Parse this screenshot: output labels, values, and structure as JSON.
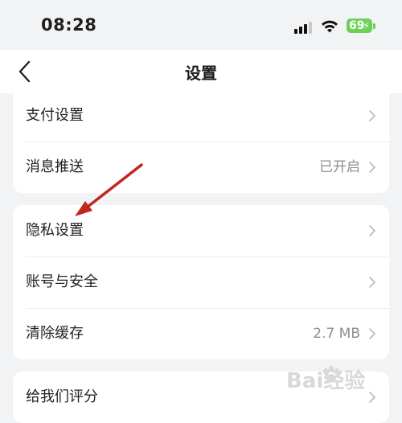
{
  "status_bar": {
    "time": "08:28",
    "battery_level": "69",
    "icons": [
      "signal-icon",
      "wifi-icon",
      "battery-charging-icon"
    ]
  },
  "nav": {
    "title": "设置",
    "back_icon": "chevron-left-icon"
  },
  "groups": [
    {
      "rows": [
        {
          "label": "支付设置",
          "value": ""
        },
        {
          "label": "消息推送",
          "value": "已开启"
        }
      ]
    },
    {
      "rows": [
        {
          "label": "隐私设置",
          "value": ""
        },
        {
          "label": "账号与安全",
          "value": ""
        },
        {
          "label": "清除缓存",
          "value": "2.7 MB"
        }
      ]
    },
    {
      "rows": [
        {
          "label": "给我们评分",
          "value": ""
        }
      ]
    }
  ],
  "annotation": {
    "color": "#c0281f",
    "points_to": "隐私设置"
  },
  "watermark": {
    "text": "Bai经验",
    "color": "#d9d9d9"
  },
  "colors": {
    "background": "#f2f3f5",
    "card": "#ffffff",
    "chevron": "#b9b9b9",
    "secondary_text": "#8e8e8e",
    "battery": "#6dd158"
  }
}
